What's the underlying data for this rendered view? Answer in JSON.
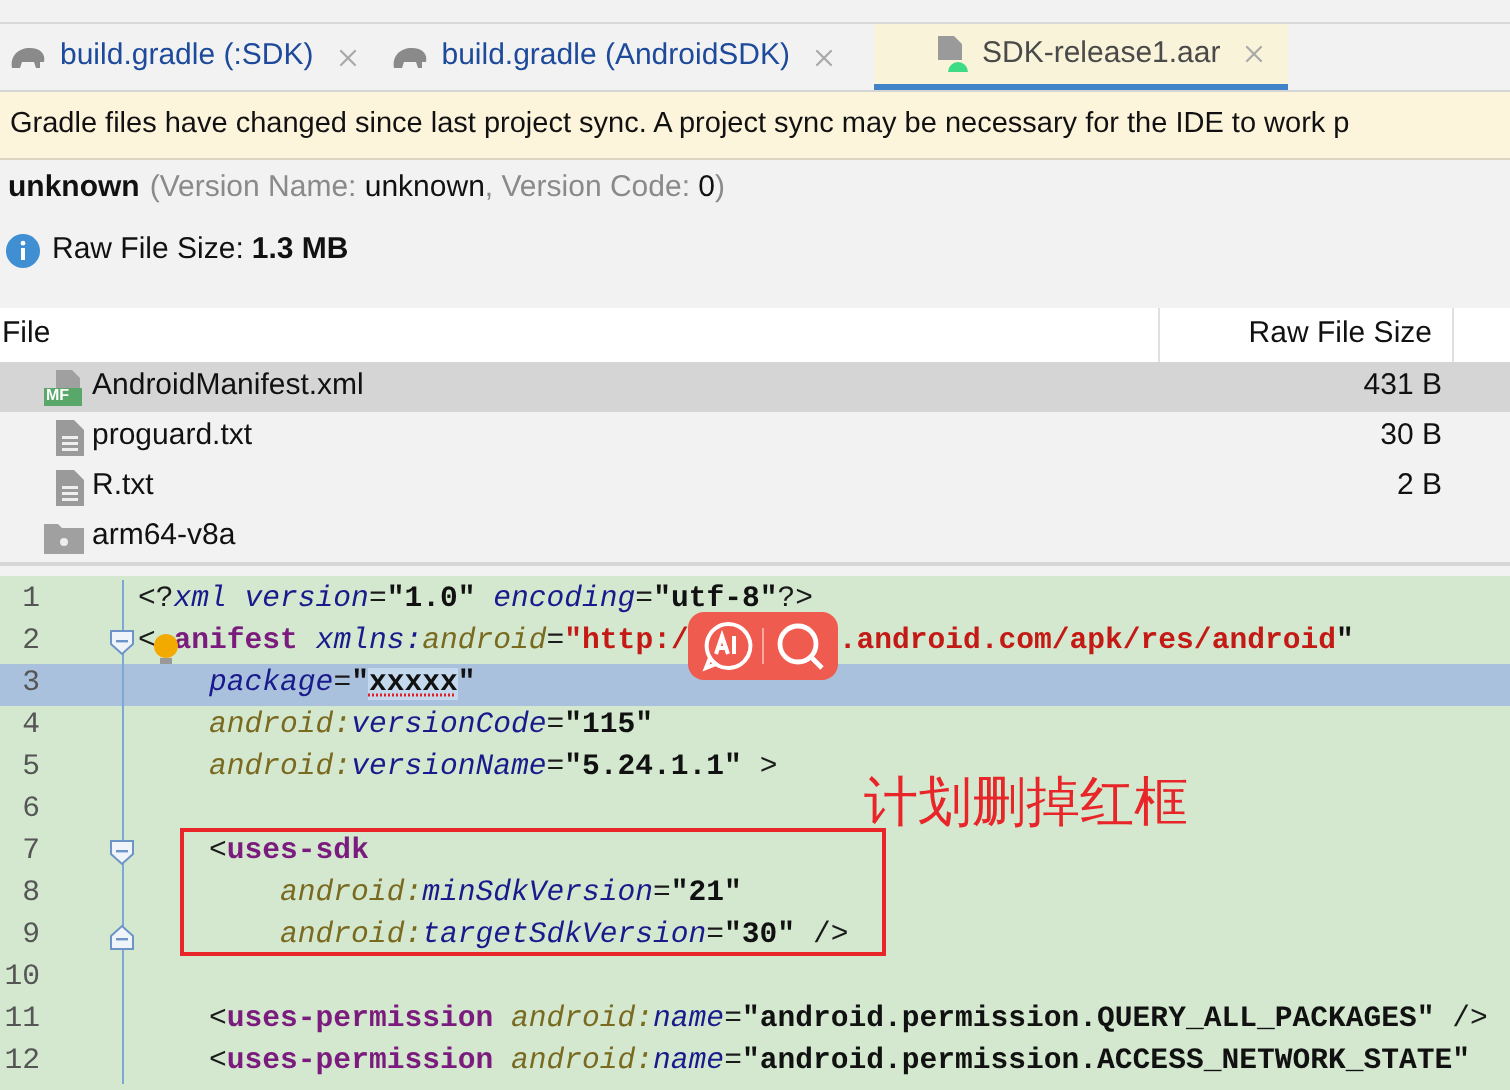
{
  "tabs": [
    {
      "label": "build.gradle (:SDK)",
      "kind": "gradle",
      "selected": false
    },
    {
      "label": "build.gradle (AndroidSDK)",
      "kind": "gradle",
      "selected": false
    },
    {
      "label": "SDK-release1.aar",
      "kind": "archive",
      "selected": true
    }
  ],
  "banner": "Gradle files have changed since last project sync. A project sync may be necessary for the IDE to work p",
  "package": {
    "name": "unknown",
    "details": [
      {
        "text": "(Version Name: ",
        "emphasis": false
      },
      {
        "text": "unknown",
        "emphasis": true
      },
      {
        "text": ", Version Code: ",
        "emphasis": false
      },
      {
        "text": "0",
        "emphasis": true
      },
      {
        "text": ")",
        "emphasis": false
      }
    ]
  },
  "info": {
    "label": "Raw File Size:",
    "value": "1.3 MB"
  },
  "table": {
    "columns": [
      "File",
      "Raw File Size"
    ],
    "rows": [
      {
        "name": "AndroidManifest.xml",
        "size": "431 B",
        "kind": "manifest",
        "icon_label": "MF",
        "selected": true
      },
      {
        "name": "proguard.txt",
        "size": "30 B",
        "kind": "text",
        "selected": false
      },
      {
        "name": "R.txt",
        "size": "2 B",
        "kind": "text",
        "selected": false
      },
      {
        "name": "arm64-v8a",
        "kind": "folder",
        "selected": false
      }
    ]
  },
  "code": {
    "lines": [
      {
        "number": "1",
        "fold_start": false,
        "fold_end": false,
        "highlighted": false,
        "segments": [
          {
            "kind": "punct",
            "text": "<?"
          },
          {
            "kind": "attr",
            "text": "xml version"
          },
          {
            "kind": "punct",
            "text": "="
          },
          {
            "kind": "value",
            "text": "\"1.0\""
          },
          {
            "kind": "attr",
            "text": " encoding"
          },
          {
            "kind": "punct",
            "text": "="
          },
          {
            "kind": "value",
            "text": "\"utf-8\""
          },
          {
            "kind": "punct",
            "text": "?>"
          }
        ]
      },
      {
        "number": "2",
        "fold_start": true,
        "fold_end": false,
        "highlighted": false,
        "segments": [
          {
            "kind": "punct",
            "text": "<"
          },
          {
            "kind": "bulb"
          },
          {
            "kind": "tag",
            "text": "anifest"
          },
          {
            "kind": "attr",
            "text": " xmlns:"
          },
          {
            "kind": "ns",
            "text": "android"
          },
          {
            "kind": "punct",
            "text": "="
          },
          {
            "kind": "url",
            "text": "\"http:/"
          },
          {
            "kind": "overlay"
          },
          {
            "kind": "url",
            "text": ".android.com/apk/res/android"
          },
          {
            "kind": "value",
            "text": "\""
          }
        ]
      },
      {
        "number": "3",
        "fold_start": false,
        "fold_end": false,
        "highlighted": true,
        "segments": [
          {
            "kind": "attr",
            "text": "    package"
          },
          {
            "kind": "punct",
            "text": "="
          },
          {
            "kind": "value",
            "text": "\""
          },
          {
            "kind": "error",
            "text": "xxxxx"
          },
          {
            "kind": "value",
            "text": "\""
          }
        ]
      },
      {
        "number": "4",
        "fold_start": false,
        "fold_end": false,
        "highlighted": false,
        "segments": [
          {
            "kind": "ns",
            "text": "    android:"
          },
          {
            "kind": "attr",
            "text": "versionCode"
          },
          {
            "kind": "punct",
            "text": "="
          },
          {
            "kind": "value",
            "text": "\"115\""
          }
        ]
      },
      {
        "number": "5",
        "fold_start": false,
        "fold_end": false,
        "highlighted": false,
        "segments": [
          {
            "kind": "ns",
            "text": "    android:"
          },
          {
            "kind": "attr",
            "text": "versionName"
          },
          {
            "kind": "punct",
            "text": "="
          },
          {
            "kind": "value",
            "text": "\"5.24.1.1\""
          },
          {
            "kind": "punct",
            "text": " >"
          }
        ]
      },
      {
        "number": "6",
        "fold_start": false,
        "fold_end": false,
        "highlighted": false
      },
      {
        "number": "7",
        "fold_start": true,
        "fold_end": false,
        "highlighted": false,
        "segments": [
          {
            "kind": "punct",
            "text": "    <"
          },
          {
            "kind": "tag",
            "text": "uses-sdk"
          }
        ]
      },
      {
        "number": "8",
        "fold_start": false,
        "fold_end": false,
        "highlighted": false,
        "segments": [
          {
            "kind": "ns",
            "text": "        android:"
          },
          {
            "kind": "attr",
            "text": "minSdkVersion"
          },
          {
            "kind": "punct",
            "text": "="
          },
          {
            "kind": "value",
            "text": "\"21\""
          }
        ]
      },
      {
        "number": "9",
        "fold_start": false,
        "fold_end": true,
        "highlighted": false,
        "segments": [
          {
            "kind": "ns",
            "text": "        android:"
          },
          {
            "kind": "attr",
            "text": "targetSdkVersion"
          },
          {
            "kind": "punct",
            "text": "="
          },
          {
            "kind": "value",
            "text": "\"30\""
          },
          {
            "kind": "punct",
            "text": " />"
          }
        ]
      },
      {
        "number": "10",
        "fold_start": false,
        "fold_end": false,
        "highlighted": false
      },
      {
        "number": "11",
        "fold_start": false,
        "fold_end": false,
        "highlighted": false,
        "segments": [
          {
            "kind": "punct",
            "text": "    <"
          },
          {
            "kind": "tag",
            "text": "uses-permission"
          },
          {
            "kind": "ns",
            "text": " android:"
          },
          {
            "kind": "attr",
            "text": "name"
          },
          {
            "kind": "punct",
            "text": "="
          },
          {
            "kind": "value",
            "text": "\"android.permission.QUERY_ALL_PACKAGES\""
          },
          {
            "kind": "punct",
            "text": " />"
          }
        ]
      },
      {
        "number": "12",
        "fold_start": false,
        "fold_end": false,
        "highlighted": false,
        "segments": [
          {
            "kind": "punct",
            "text": "    <"
          },
          {
            "kind": "tag",
            "text": "uses-permission"
          },
          {
            "kind": "ns",
            "text": " android:"
          },
          {
            "kind": "attr",
            "text": "name"
          },
          {
            "kind": "punct",
            "text": "="
          },
          {
            "kind": "value",
            "text": "\"android.permission.ACCESS_NETWORK_STATE\""
          }
        ]
      }
    ],
    "annotation": "计划删掉红框"
  }
}
